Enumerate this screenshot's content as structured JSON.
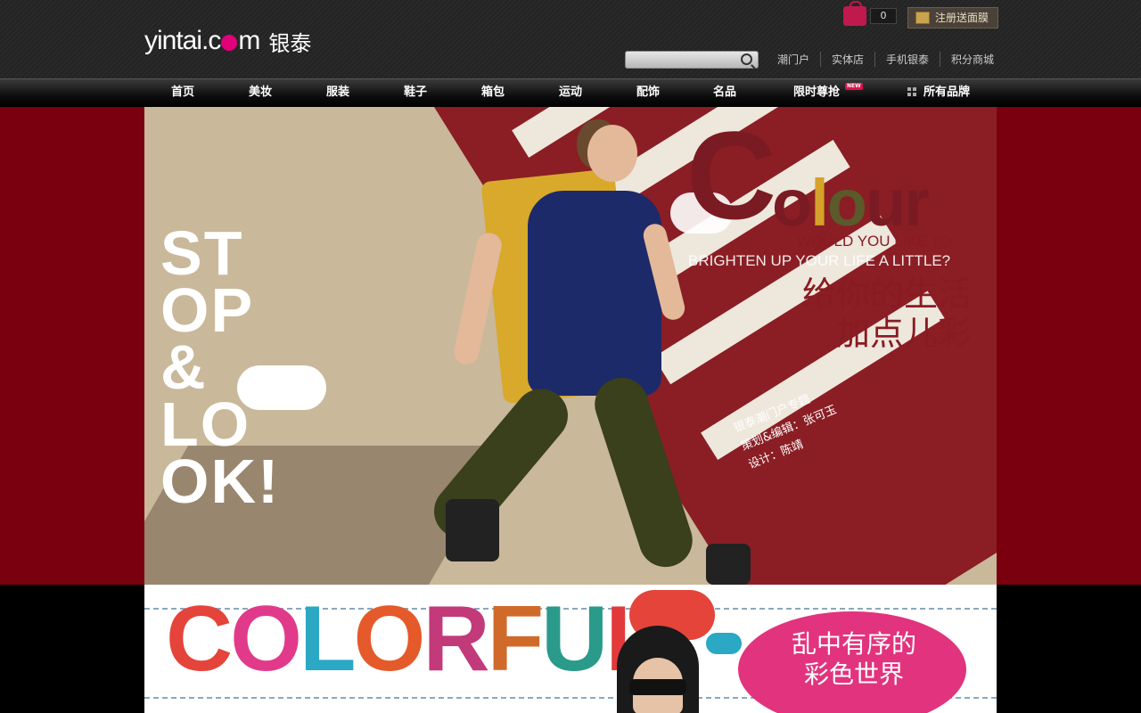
{
  "header": {
    "logo_en_prefix": "yintai.c",
    "logo_en_suffix": "m",
    "logo_cn": "银泰",
    "cart_count": "0",
    "register_label": "注册送面膜",
    "search": {
      "placeholder": "",
      "value": ""
    },
    "top_links": [
      "潮门户",
      "实体店",
      "手机银泰",
      "积分商城"
    ]
  },
  "nav": {
    "items": [
      {
        "label": "首页"
      },
      {
        "label": "美妆"
      },
      {
        "label": "服装"
      },
      {
        "label": "鞋子"
      },
      {
        "label": "箱包"
      },
      {
        "label": "运动"
      },
      {
        "label": "配饰"
      },
      {
        "label": "名品"
      },
      {
        "label": "限时尊抢",
        "badge": "NEW"
      },
      {
        "label": "所有品牌",
        "icon": "grid-icon"
      }
    ]
  },
  "hero": {
    "stop_look": [
      "ST",
      "OP",
      "&",
      "LO",
      "OK!"
    ],
    "colour_c": "C",
    "colour_rest": [
      "o",
      "l",
      "o",
      "ur"
    ],
    "tagline_1": "WOULD YOU LIKE TO",
    "tagline_2": "BRIGHTEN UP YOUR LIFE A LITTLE?",
    "slogan_cn": [
      "给你的生活",
      "加点儿彩"
    ],
    "credits": [
      "银泰潮门户专题",
      "策划&编辑：张可玉",
      "设计：陈靖"
    ],
    "colors": {
      "brand_red": "#7a0010",
      "road": "#8a1e24",
      "chair": "#d8a92a",
      "dress": "#1c2a6a"
    }
  },
  "banner2": {
    "colorful_letters": [
      "C",
      "O",
      "L",
      "O",
      "R",
      "F",
      "U",
      "L"
    ],
    "bubble_cn": [
      "乱中有序的",
      "彩色世界"
    ],
    "colors": {
      "pink": "#e2337e"
    }
  }
}
